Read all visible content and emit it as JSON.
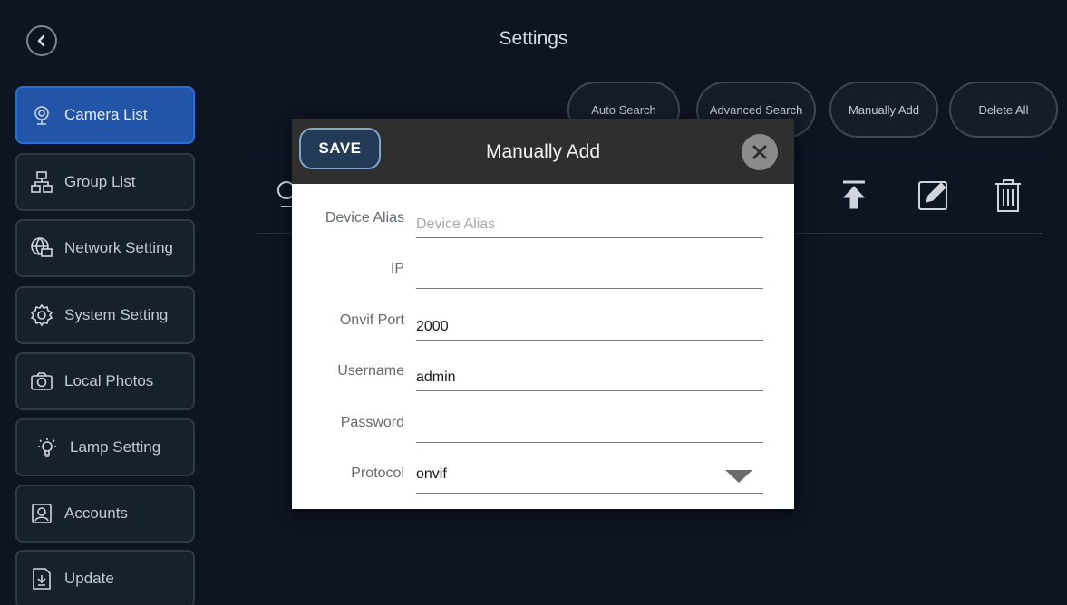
{
  "header": {
    "title": "Settings",
    "back_icon": "chevron-left-icon"
  },
  "sidebar": {
    "items": [
      {
        "label": "Camera List",
        "icon": "camera-icon",
        "active": true
      },
      {
        "label": "Group List",
        "icon": "group-icon",
        "active": false
      },
      {
        "label": "Network Setting",
        "icon": "network-icon",
        "active": false
      },
      {
        "label": "System Setting",
        "icon": "gear-icon",
        "active": false
      },
      {
        "label": "Local Photos",
        "icon": "photo-camera-icon",
        "active": false
      },
      {
        "label": "Lamp Setting",
        "icon": "lamp-icon",
        "active": false
      },
      {
        "label": "Accounts",
        "icon": "account-icon",
        "active": false
      },
      {
        "label": "Update",
        "icon": "update-icon",
        "active": false
      }
    ]
  },
  "actions": {
    "auto_search": "Auto Search",
    "advanced_search": "Advanced Search",
    "manually_add": "Manually Add",
    "delete_all": "Delete All"
  },
  "toolbar_icons": [
    "move-to-top-icon",
    "edit-icon",
    "trash-icon"
  ],
  "dialog": {
    "title": "Manually Add",
    "save_label": "SAVE",
    "close_icon": "close-icon",
    "fields": {
      "device_alias": {
        "label": "Device Alias",
        "value": "",
        "placeholder": "Device Alias"
      },
      "ip": {
        "label": "IP",
        "value": "",
        "placeholder": ""
      },
      "onvif_port": {
        "label": "Onvif Port",
        "value": "2000",
        "placeholder": ""
      },
      "username": {
        "label": "Username",
        "value": "admin",
        "placeholder": ""
      },
      "password": {
        "label": "Password",
        "value": "",
        "placeholder": ""
      },
      "protocol": {
        "label": "Protocol",
        "value": "onvif"
      }
    }
  },
  "colors": {
    "background": "#0e1522",
    "active_item": "#2255a8",
    "dialog_header": "#2f2f2f"
  }
}
